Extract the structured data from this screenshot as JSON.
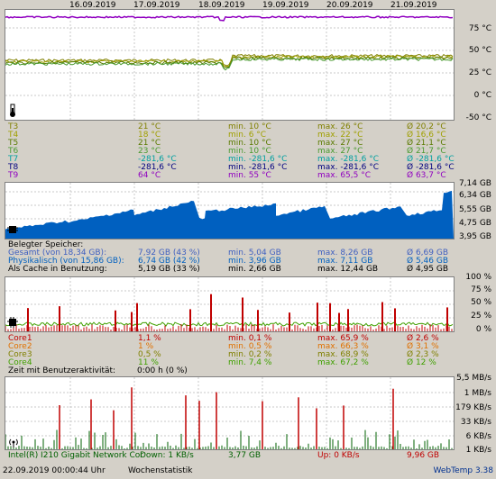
{
  "dates": [
    "16.09.2019",
    "17.09.2019",
    "18.09.2019",
    "19.09.2019",
    "20.09.2019",
    "21.09.2019"
  ],
  "temp": {
    "y_labels": [
      "75 °C",
      "50 °C",
      "25 °C",
      "0 °C",
      "-25 °C",
      "-50 °C"
    ],
    "rows": [
      {
        "name": "T3",
        "cur": "21 °C",
        "min": "min. 10 °C",
        "max": "max. 26 °C",
        "avg": "Ø 20,2 °C",
        "color": "#808000"
      },
      {
        "name": "T4",
        "cur": "18 °C",
        "min": "min. 6 °C",
        "max": "max. 22 °C",
        "avg": "Ø 16,6 °C",
        "color": "#a0a000"
      },
      {
        "name": "T5",
        "cur": "21 °C",
        "min": "min. 10 °C",
        "max": "max. 27 °C",
        "avg": "Ø 21,1 °C",
        "color": "#5a7a00"
      },
      {
        "name": "T6",
        "cur": "23 °C",
        "min": "min. 10 °C",
        "max": "max. 27 °C",
        "avg": "Ø 21,7 °C",
        "color": "#4a9a30"
      },
      {
        "name": "T7",
        "cur": "-281,6 °C",
        "min": "min. -281,6 °C",
        "max": "max. -281,6 °C",
        "avg": "Ø -281,6 °C",
        "color": "#00a0a0"
      },
      {
        "name": "T8",
        "cur": "-281,6 °C",
        "min": "min. -281,6 °C",
        "max": "max. -281,6 °C",
        "avg": "Ø -281,6 °C",
        "color": "#000080"
      },
      {
        "name": "T9",
        "cur": "64 °C",
        "min": "min. 55 °C",
        "max": "max. 65,5 °C",
        "avg": "Ø 63,7 °C",
        "color": "#9000c0"
      }
    ]
  },
  "mem": {
    "y_labels": [
      "7,14 GB",
      "6,34 GB",
      "5,55 GB",
      "4,75 GB",
      "3,95 GB"
    ],
    "heading": "Belegter Speicher:",
    "rows": [
      {
        "name": "Gesamt (von 18,34 GB):",
        "cur": "7,92 GB (43 %)",
        "min": "min. 5,04 GB",
        "max": "max. 8,26 GB",
        "avg": "Ø 6,69 GB",
        "color": "#4060c0"
      },
      {
        "name": "Physikalisch (von 15,86 GB):",
        "cur": "6,74 GB (42 %)",
        "min": "min. 3,96 GB",
        "max": "max. 7,11 GB",
        "avg": "Ø 5,46 GB",
        "color": "#0060c0"
      },
      {
        "name": "Als Cache in Benutzung:",
        "cur": "5,19 GB (33 %)",
        "min": "min. 2,66 GB",
        "max": "max. 12,44 GB",
        "avg": "Ø 4,95 GB",
        "color": "#000000"
      }
    ]
  },
  "cpu": {
    "y_labels": [
      "100 %",
      "75 %",
      "50 %",
      "25 %",
      "0 %"
    ],
    "rows": [
      {
        "name": "Core1",
        "cur": "1,1 %",
        "min": "min. 0,1 %",
        "max": "max. 65,9 %",
        "avg": "Ø 2,6 %",
        "color": "#c00000"
      },
      {
        "name": "Core2",
        "cur": "1 %",
        "min": "min. 0,5 %",
        "max": "max. 66,3 %",
        "avg": "Ø 3,1 %",
        "color": "#e07000"
      },
      {
        "name": "Core3",
        "cur": "0,5 %",
        "min": "min. 0,2 %",
        "max": "max. 68,9 %",
        "avg": "Ø 2,3 %",
        "color": "#808000"
      },
      {
        "name": "Core4",
        "cur": "11 %",
        "min": "min. 7,4 %",
        "max": "max. 67,2 %",
        "avg": "Ø 12 %",
        "color": "#40a000"
      }
    ],
    "idle_label": "Zeit mit Benutzeraktivität:",
    "idle_value": "0:00 h (0 %)"
  },
  "net": {
    "y_labels": [
      "5,5 MB/s",
      "1 MB/s",
      "179 KB/s",
      "33 KB/s",
      "6 KB/s",
      "1 KB/s"
    ],
    "adapter": "Intel(R) I210 Gigabit Network Cor",
    "down": "Down: 1 KB/s",
    "down_total": "3,77 GB",
    "up": "Up: 0 KB/s",
    "up_total": "9,96 GB"
  },
  "footer": {
    "timestamp": "22.09.2019 00:00:44 Uhr",
    "stat": "Wochenstatistik",
    "app": "WebTemp 3.38"
  },
  "icons": [
    "thermometer-icon",
    "memory-chip-icon",
    "cpu-chip-icon",
    "network-icon"
  ]
}
